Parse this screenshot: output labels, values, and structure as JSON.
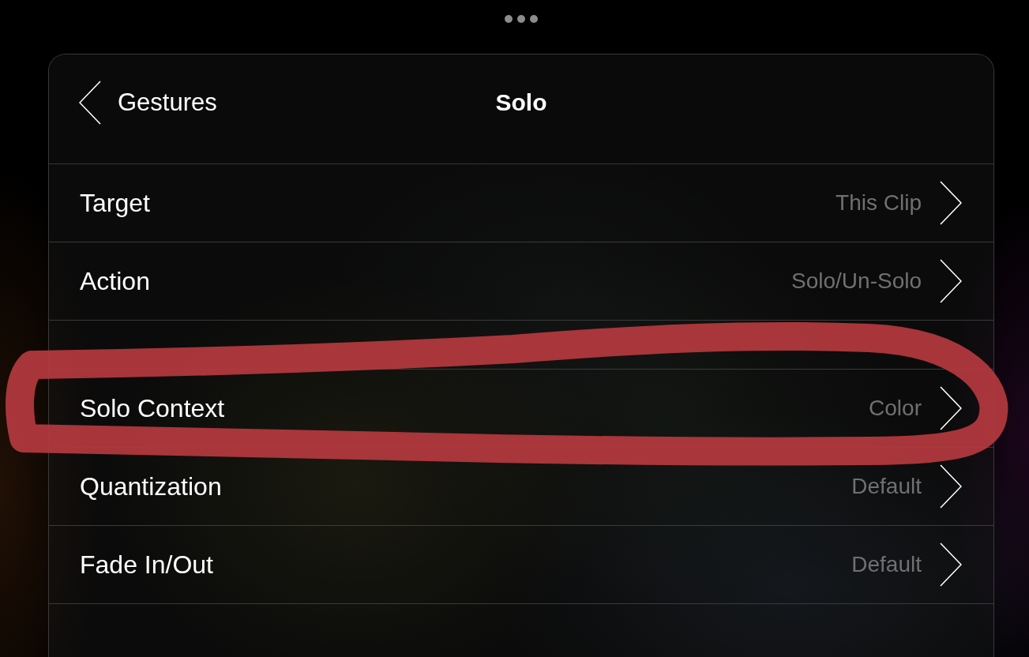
{
  "nav_bar": {
    "back_label": "Gestures",
    "title": "Solo"
  },
  "sections": [
    {
      "rows": [
        {
          "label": "Target",
          "value": "This Clip",
          "circled": false
        },
        {
          "label": "Action",
          "value": "Solo/Un-Solo",
          "circled": false
        }
      ]
    },
    {
      "rows": [
        {
          "label": "Solo Context",
          "value": "Color",
          "circled": true
        },
        {
          "label": "Quantization",
          "value": "Default",
          "circled": false
        },
        {
          "label": "Fade In/Out",
          "value": "Default",
          "circled": false
        }
      ]
    }
  ]
}
